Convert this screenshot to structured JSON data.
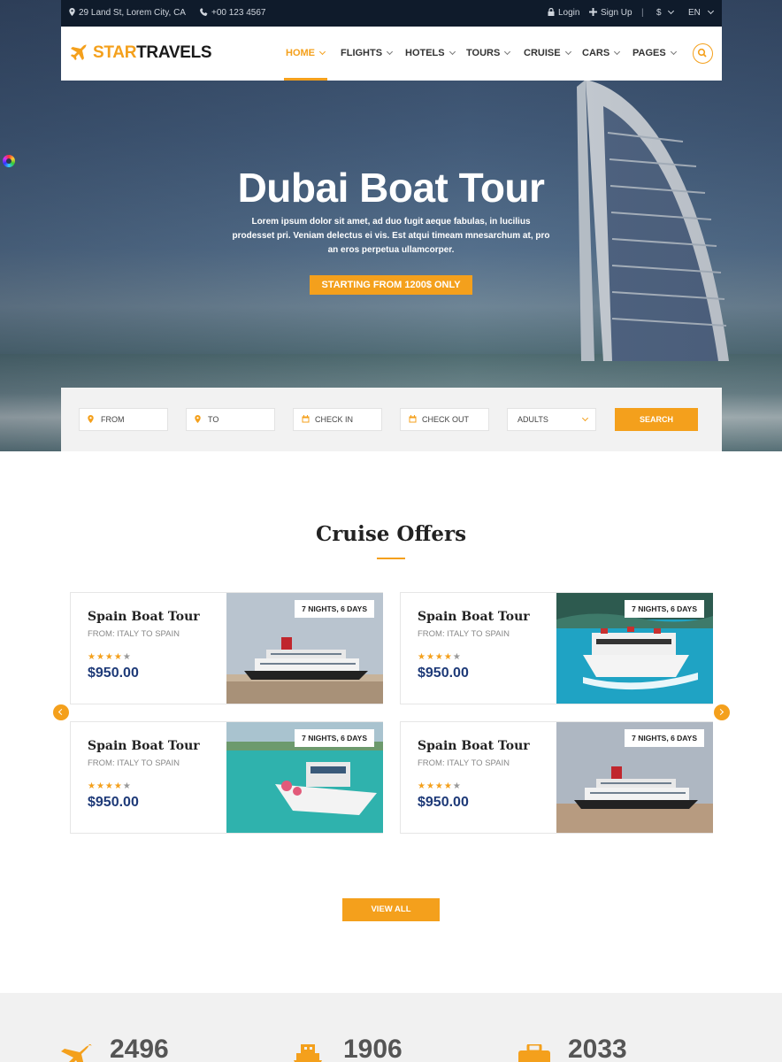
{
  "topbar": {
    "address": "29 Land St, Lorem City, CA",
    "phone": "+00 123 4567",
    "login": "Login",
    "signup": "Sign Up",
    "currency": "$",
    "language": "EN"
  },
  "brand": {
    "star": "STAR",
    "travels": "TRAVELS"
  },
  "nav": [
    {
      "label": "HOME",
      "active": true
    },
    {
      "label": "FLIGHTS"
    },
    {
      "label": "HOTELS"
    },
    {
      "label": "TOURS"
    },
    {
      "label": "CRUISE"
    },
    {
      "label": "CARS"
    },
    {
      "label": "PAGES"
    }
  ],
  "hero": {
    "title": "Dubai Boat Tour",
    "text": "Lorem ipsum dolor sit amet, ad duo fugit aeque fabulas, in lucilius prodesset pri. Veniam delectus ei vis. Est atqui timeam mnesarchum at, pro an eros perpetua ullamcorper.",
    "button": "STARTING FROM 1200$ ONLY"
  },
  "search": {
    "from": "FROM",
    "to": "TO",
    "checkin": "CHECK IN",
    "checkout": "CHECK OUT",
    "adults": "ADULTS",
    "button": "SEARCH"
  },
  "section": {
    "title": "Cruise Offers"
  },
  "offers": [
    {
      "title": "Spain Boat Tour",
      "route": "FROM: ITALY TO SPAIN",
      "price": "$950.00",
      "badge": "7 NIGHTS, 6 DAYS",
      "rating": 4
    },
    {
      "title": "Spain Boat Tour",
      "route": "FROM: ITALY TO SPAIN",
      "price": "$950.00",
      "badge": "7 NIGHTS, 6 DAYS",
      "rating": 4
    },
    {
      "title": "Spain Boat Tour",
      "route": "FROM: ITALY TO SPAIN",
      "price": "$950.00",
      "badge": "7 NIGHTS, 6 DAYS",
      "rating": 4
    },
    {
      "title": "Spain Boat Tour",
      "route": "FROM: ITALY TO SPAIN",
      "price": "$950.00",
      "badge": "7 NIGHTS, 6 DAYS",
      "rating": 4
    }
  ],
  "view_all": "VIEW ALL",
  "stats": [
    {
      "value": "2496",
      "icon": "plane-icon"
    },
    {
      "value": "1906",
      "icon": "ship-icon"
    },
    {
      "value": "2033",
      "icon": "luggage-icon"
    }
  ],
  "colors": {
    "accent": "#f4a01c",
    "price": "#1e3a78",
    "topbar": "#0f1b2b"
  }
}
